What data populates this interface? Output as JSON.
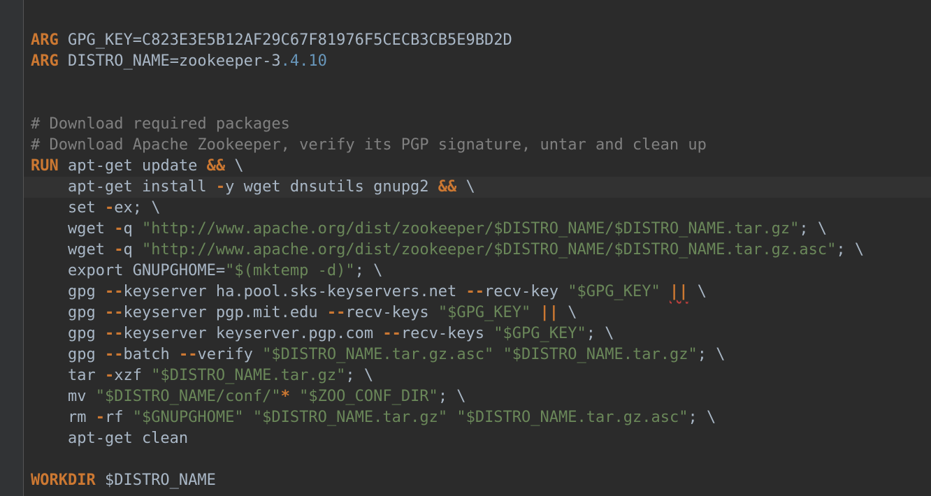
{
  "colors": {
    "background": "#2b2b2b",
    "gutter": "#313335",
    "keyword": "#cc7832",
    "string": "#6a8759",
    "number": "#6897bb",
    "comment": "#808080",
    "text": "#a9b7c6",
    "current_line": "#323232",
    "error_underline": "#bc3f3c"
  },
  "lines": [
    [
      {
        "t": "kw",
        "s": "ARG"
      },
      {
        "t": "plain",
        "s": " GPG_KEY=C823E3E5B12AF29C67F81976F5CECB3CB5E9BD2D"
      }
    ],
    [
      {
        "t": "kw",
        "s": "ARG"
      },
      {
        "t": "plain",
        "s": " DISTRO_NAME=zookeeper-3"
      },
      {
        "t": "num",
        "s": ".4.10"
      }
    ],
    [],
    [],
    [
      {
        "t": "cmt",
        "s": "# Download required packages"
      }
    ],
    [
      {
        "t": "cmt",
        "s": "# Download Apache Zookeeper, verify its PGP signature, untar and clean up"
      }
    ],
    [
      {
        "t": "kw",
        "s": "RUN"
      },
      {
        "t": "plain",
        "s": " apt-get update "
      },
      {
        "t": "op",
        "s": "&&"
      },
      {
        "t": "plain",
        "s": " \\"
      }
    ],
    [
      {
        "t": "plain",
        "s": "    apt-get install "
      },
      {
        "t": "op",
        "s": "-"
      },
      {
        "t": "plain",
        "s": "y wget dnsutils gnupg2 "
      },
      {
        "t": "op",
        "s": "&&"
      },
      {
        "t": "plain",
        "s": " \\"
      }
    ],
    [
      {
        "t": "plain",
        "s": "    set "
      },
      {
        "t": "op",
        "s": "-"
      },
      {
        "t": "plain",
        "s": "ex; \\"
      }
    ],
    [
      {
        "t": "plain",
        "s": "    wget "
      },
      {
        "t": "op",
        "s": "-"
      },
      {
        "t": "plain",
        "s": "q "
      },
      {
        "t": "str",
        "s": "\"http://www.apache.org/dist/zookeeper/$DISTRO_NAME/$DISTRO_NAME.tar.gz\""
      },
      {
        "t": "plain",
        "s": "; \\"
      }
    ],
    [
      {
        "t": "plain",
        "s": "    wget "
      },
      {
        "t": "op",
        "s": "-"
      },
      {
        "t": "plain",
        "s": "q "
      },
      {
        "t": "str",
        "s": "\"http://www.apache.org/dist/zookeeper/$DISTRO_NAME/$DISTRO_NAME.tar.gz.asc\""
      },
      {
        "t": "plain",
        "s": "; \\"
      }
    ],
    [
      {
        "t": "plain",
        "s": "    export GNUPGHOME="
      },
      {
        "t": "str",
        "s": "\"$(mktemp -d)\""
      },
      {
        "t": "plain",
        "s": "; \\"
      }
    ],
    [
      {
        "t": "plain",
        "s": "    gpg "
      },
      {
        "t": "op",
        "s": "--"
      },
      {
        "t": "plain",
        "s": "keyserver ha.pool.sks-keyservers.net "
      },
      {
        "t": "op",
        "s": "--"
      },
      {
        "t": "plain",
        "s": "recv-key "
      },
      {
        "t": "str",
        "s": "\"$GPG_KEY\""
      },
      {
        "t": "plain",
        "s": " "
      },
      {
        "t": "op warn",
        "s": "||"
      },
      {
        "t": "plain",
        "s": " \\"
      }
    ],
    [
      {
        "t": "plain",
        "s": "    gpg "
      },
      {
        "t": "op",
        "s": "--"
      },
      {
        "t": "plain",
        "s": "keyserver pgp.mit.edu "
      },
      {
        "t": "op",
        "s": "--"
      },
      {
        "t": "plain",
        "s": "recv-keys "
      },
      {
        "t": "str",
        "s": "\"$GPG_KEY\""
      },
      {
        "t": "plain",
        "s": " "
      },
      {
        "t": "op",
        "s": "||"
      },
      {
        "t": "plain",
        "s": " \\"
      }
    ],
    [
      {
        "t": "plain",
        "s": "    gpg "
      },
      {
        "t": "op",
        "s": "--"
      },
      {
        "t": "plain",
        "s": "keyserver keyserver.pgp.com "
      },
      {
        "t": "op",
        "s": "--"
      },
      {
        "t": "plain",
        "s": "recv-keys "
      },
      {
        "t": "str",
        "s": "\"$GPG_KEY\""
      },
      {
        "t": "plain",
        "s": "; \\"
      }
    ],
    [
      {
        "t": "plain",
        "s": "    gpg "
      },
      {
        "t": "op",
        "s": "--"
      },
      {
        "t": "plain",
        "s": "batch "
      },
      {
        "t": "op",
        "s": "--"
      },
      {
        "t": "plain",
        "s": "verify "
      },
      {
        "t": "str",
        "s": "\"$DISTRO_NAME.tar.gz.asc\""
      },
      {
        "t": "plain",
        "s": " "
      },
      {
        "t": "str",
        "s": "\"$DISTRO_NAME.tar.gz\""
      },
      {
        "t": "plain",
        "s": "; \\"
      }
    ],
    [
      {
        "t": "plain",
        "s": "    tar "
      },
      {
        "t": "op",
        "s": "-"
      },
      {
        "t": "plain",
        "s": "xzf "
      },
      {
        "t": "str",
        "s": "\"$DISTRO_NAME.tar.gz\""
      },
      {
        "t": "plain",
        "s": "; \\"
      }
    ],
    [
      {
        "t": "plain",
        "s": "    mv "
      },
      {
        "t": "str",
        "s": "\"$DISTRO_NAME/conf/\""
      },
      {
        "t": "op",
        "s": "*"
      },
      {
        "t": "plain",
        "s": " "
      },
      {
        "t": "str",
        "s": "\"$ZOO_CONF_DIR\""
      },
      {
        "t": "plain",
        "s": "; \\"
      }
    ],
    [
      {
        "t": "plain",
        "s": "    rm "
      },
      {
        "t": "op",
        "s": "-"
      },
      {
        "t": "plain",
        "s": "rf "
      },
      {
        "t": "str",
        "s": "\"$GNUPGHOME\""
      },
      {
        "t": "plain",
        "s": " "
      },
      {
        "t": "str",
        "s": "\"$DISTRO_NAME.tar.gz\""
      },
      {
        "t": "plain",
        "s": " "
      },
      {
        "t": "str",
        "s": "\"$DISTRO_NAME.tar.gz.asc\""
      },
      {
        "t": "plain",
        "s": "; \\"
      }
    ],
    [
      {
        "t": "plain",
        "s": "    apt-get clean"
      }
    ],
    [],
    [
      {
        "t": "kw",
        "s": "WORKDIR"
      },
      {
        "t": "plain",
        "s": " $DISTRO_NAME"
      }
    ]
  ],
  "current_line_index": 7
}
